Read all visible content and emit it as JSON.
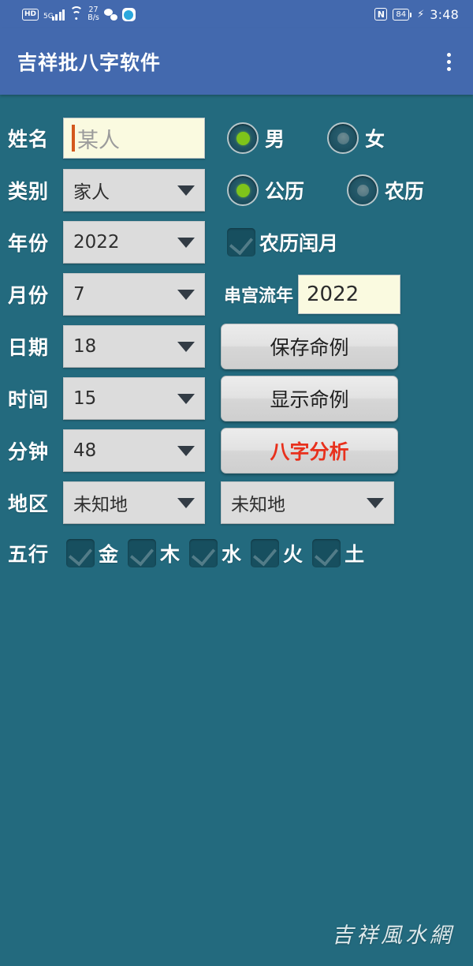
{
  "statusbar": {
    "hd_label": "HD",
    "network_type": "5G",
    "net_speed_value": "27",
    "net_speed_unit": "B/s",
    "nfc_label": "N",
    "battery_level": "84",
    "charging_glyph": "⚡",
    "time": "3:48",
    "icons": [
      "hd-icon",
      "signal-icon",
      "wifi-icon",
      "network-speed",
      "wechat-icon",
      "app-icon",
      "nfc-icon",
      "battery-icon",
      "charging-icon"
    ]
  },
  "appbar": {
    "title": "吉祥批八字软件",
    "overflow_icon": "more-vertical-icon"
  },
  "form": {
    "name": {
      "label": "姓名",
      "value": "",
      "placeholder": "某人"
    },
    "gender": {
      "options": [
        {
          "label": "男",
          "selected": true
        },
        {
          "label": "女",
          "selected": false
        }
      ]
    },
    "category": {
      "label": "类别",
      "value": "家人"
    },
    "calendar": {
      "options": [
        {
          "label": "公历",
          "selected": true
        },
        {
          "label": "农历",
          "selected": false
        }
      ]
    },
    "year": {
      "label": "年份",
      "value": "2022"
    },
    "leap_month": {
      "label": "农历闰月",
      "checked": true
    },
    "month": {
      "label": "月份",
      "value": "7"
    },
    "chuangong": {
      "label": "串宫流年",
      "value": "2022"
    },
    "day": {
      "label": "日期",
      "value": "18"
    },
    "hour": {
      "label": "时间",
      "value": "15"
    },
    "minute": {
      "label": "分钟",
      "value": "48"
    },
    "region": {
      "label": "地区",
      "value1": "未知地",
      "value2": "未知地"
    },
    "wuxing": {
      "label": "五行",
      "items": [
        {
          "label": "金",
          "checked": true
        },
        {
          "label": "木",
          "checked": true
        },
        {
          "label": "水",
          "checked": true
        },
        {
          "label": "火",
          "checked": true
        },
        {
          "label": "土",
          "checked": true
        }
      ]
    }
  },
  "buttons": {
    "save": "保存命例",
    "show": "显示命例",
    "analyze": "八字分析"
  },
  "watermark": "吉祥風水網",
  "colors": {
    "background": "#236a7e",
    "appbar": "#4369ae",
    "statusbar": "#4369ae",
    "field_cream": "#fafae0",
    "spinner_gray": "#dcdcdc",
    "radio_selected": "#7fc41a",
    "accent_red": "#e8301c",
    "caret_orange": "#d4581c"
  }
}
